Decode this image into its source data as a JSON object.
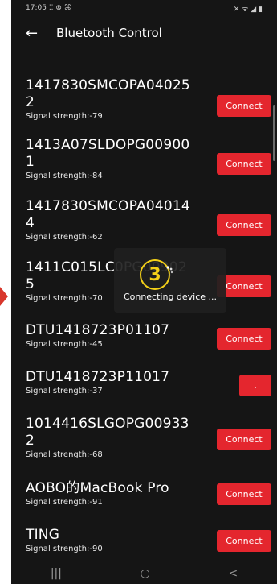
{
  "status_bar": {
    "time": "17:05",
    "left_icons": "⁚⁚ ⊗ ⌘",
    "right_icons": "✕ ᯤ ◢ ▮"
  },
  "app_bar": {
    "back_icon": "←",
    "title": "Bluetooth Control"
  },
  "devices": [
    {
      "name": "1417830SMCOPA040252",
      "signal": "Signal strength:-79",
      "button": "Connect"
    },
    {
      "name": "1413A07SLDOPG009001",
      "signal": "Signal strength:-84",
      "button": "Connect"
    },
    {
      "name": "1417830SMCOPA040144",
      "signal": "Signal strength:-62",
      "button": "Connect"
    },
    {
      "name": "1411C015LC0PG009025",
      "signal": "Signal strength:-70",
      "button": "Connect"
    },
    {
      "name": "DTU1418723P01107",
      "signal": "Signal strength:-45",
      "button": "Connect"
    },
    {
      "name": "DTU1418723P11017",
      "signal": "Signal strength:-37",
      "button": "."
    },
    {
      "name": "1014416SLGOPG009332",
      "signal": "Signal strength:-68",
      "button": "Connect"
    },
    {
      "name": "AOBO的MacBook Pro",
      "signal": "Signal strength:-91",
      "button": "Connect"
    },
    {
      "name": "TING",
      "signal": "Signal strength:-90",
      "button": "Connect"
    }
  ],
  "overlay": {
    "step": "3",
    "message": "Connecting device ..."
  },
  "nav_bar": {
    "recent": "|||",
    "home": "○",
    "back": "<"
  },
  "colors": {
    "accent": "#e4262e",
    "background": "#151515",
    "step_badge": "#f4d018"
  }
}
